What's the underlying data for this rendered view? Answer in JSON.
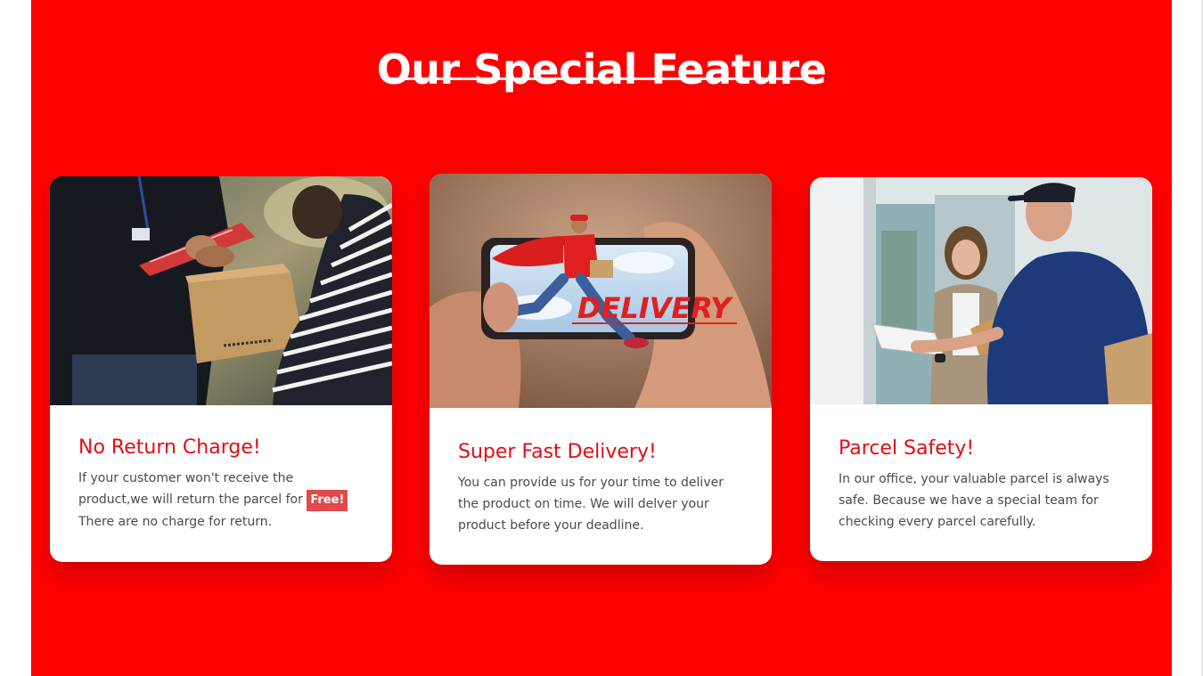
{
  "section": {
    "heading": "Our Special Feature",
    "accent_color": "#ff0000",
    "title_color": "#e00d16"
  },
  "cards": [
    {
      "title": "No Return Charge!",
      "text_before": "If your customer won't receive the product,we will return the parcel for",
      "badge": "Free!",
      "text_after": "There are no charge for return.",
      "image": "courier-handing-box-photo"
    },
    {
      "title": "Super Fast Delivery!",
      "text": "You can provide us for your time to deliver the product on time. We will delver your product before your deadline.",
      "image": "phone-delivery-photo",
      "image_caption": "DELIVERY"
    },
    {
      "title": "Parcel Safety!",
      "text": "In our office, your valuable parcel is always safe. Because we have a special team for checking every parcel carefully.",
      "image": "parcel-signing-photo"
    }
  ]
}
